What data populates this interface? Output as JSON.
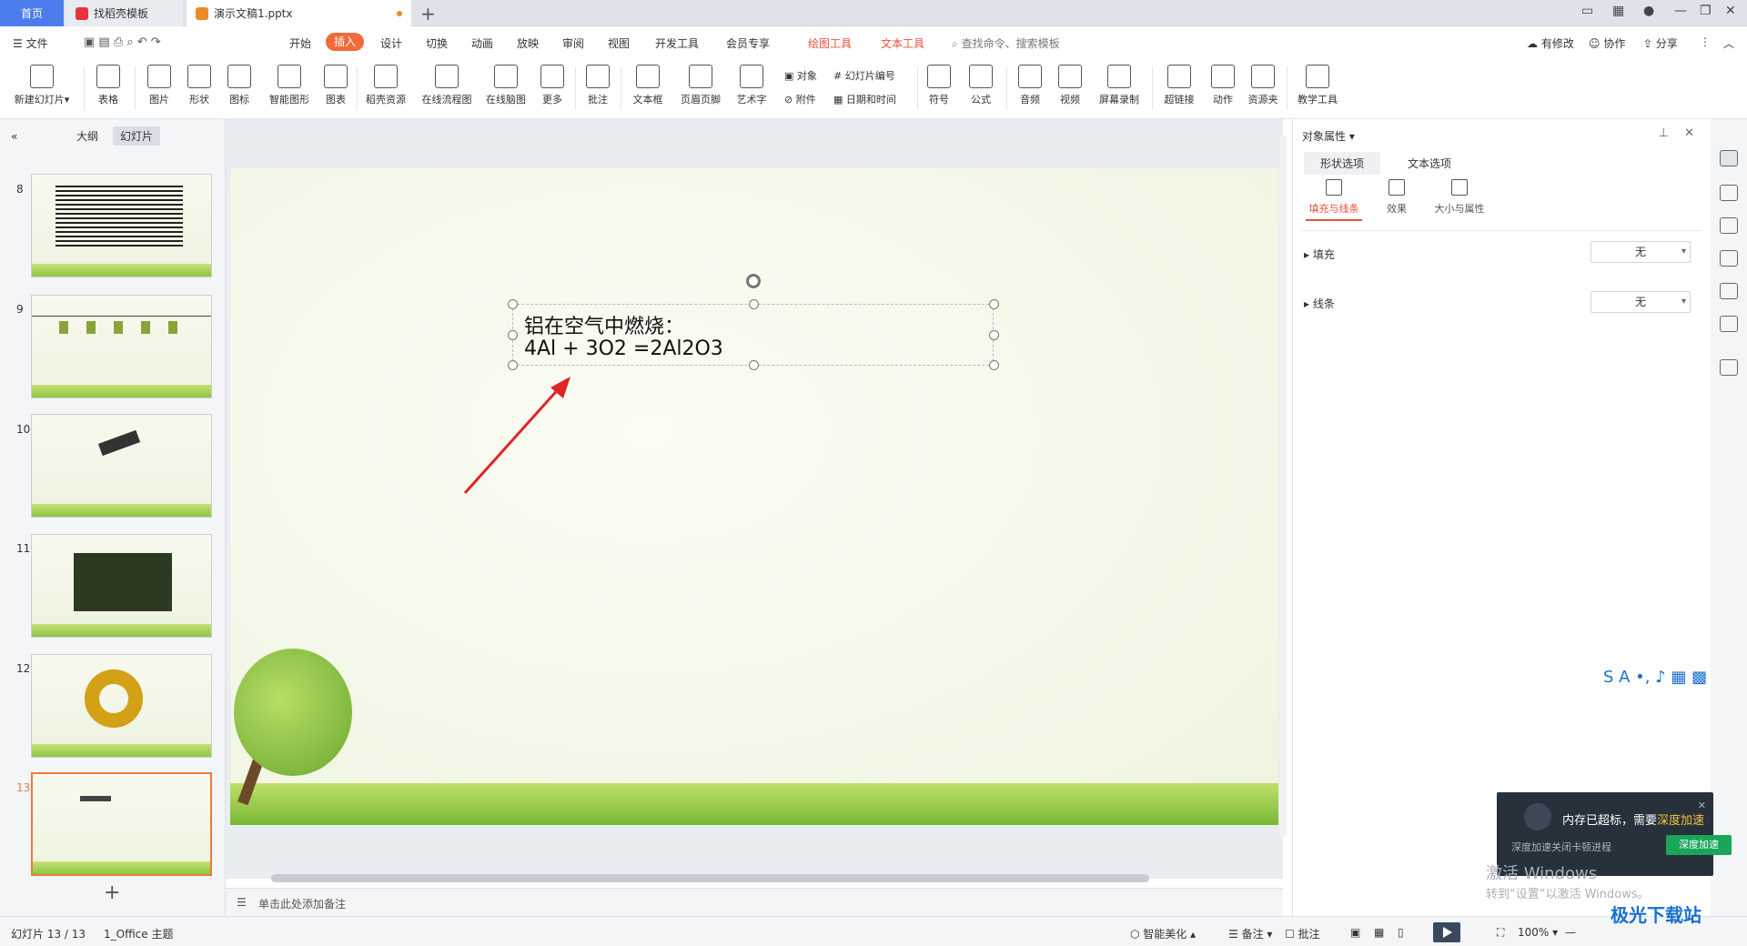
{
  "tabs": {
    "home": "首页",
    "template": "找稻壳模板",
    "document": "演示文稿1.pptx"
  },
  "menu": {
    "file": "文件",
    "items": [
      "开始",
      "插入",
      "设计",
      "切换",
      "动画",
      "放映",
      "审阅",
      "视图",
      "开发工具",
      "会员专享"
    ],
    "active": "插入",
    "context": [
      "绘图工具",
      "文本工具"
    ],
    "search": "查找命令、搜索模板",
    "right": [
      "有修改",
      "协作",
      "分享"
    ]
  },
  "ribbon": {
    "buttons": [
      "新建幻灯片",
      "表格",
      "图片",
      "形状",
      "图标",
      "智能图形",
      "图表",
      "稻壳资源",
      "在线流程图",
      "在线脑图",
      "更多",
      "批注",
      "文本框",
      "页眉页脚",
      "艺术字",
      "符号",
      "公式",
      "音频",
      "视频",
      "屏幕录制",
      "超链接",
      "动作",
      "资源夹",
      "教学工具"
    ],
    "small": [
      "对象",
      "幻灯片编号",
      "附件",
      "日期和时间"
    ]
  },
  "leftpane": {
    "tabs": [
      "大纲",
      "幻灯片"
    ],
    "active_tab": "幻灯片",
    "slides": [
      "8",
      "9",
      "10",
      "11",
      "12",
      "13"
    ],
    "selected": "13"
  },
  "slide": {
    "line1": "铝在空气中燃烧：",
    "line2": "4Al + 3O2 =2Al2O3"
  },
  "notes": {
    "placeholder": "单击此处添加备注"
  },
  "rightpane": {
    "title": "对象属性",
    "tabs": [
      "形状选项",
      "文本选项"
    ],
    "active_tab": "形状选项",
    "subtabs": [
      "填充与线条",
      "效果",
      "大小与属性"
    ],
    "active_subtab": "填充与线条",
    "fill_label": "填充",
    "fill_value": "无",
    "line_label": "线条",
    "line_value": "无"
  },
  "popup": {
    "text": "内存已超标，需要",
    "highlight": "深度加速",
    "sub": "深度加速关闭卡顿进程",
    "button": "深度加速"
  },
  "watermark": {
    "line1": "激活 Windows",
    "line2": "转到“设置”以激活 Windows。"
  },
  "status": {
    "slide": "幻灯片 13 / 13",
    "theme": "1_Office 主题",
    "beautify": "智能美化",
    "notes": "备注",
    "comments": "批注",
    "zoom": "100%",
    "site": "极光下载站"
  },
  "colors": {
    "accent": "#f26b3a",
    "home_tab": "#4d7ded",
    "context_tab": "#e8503a"
  }
}
